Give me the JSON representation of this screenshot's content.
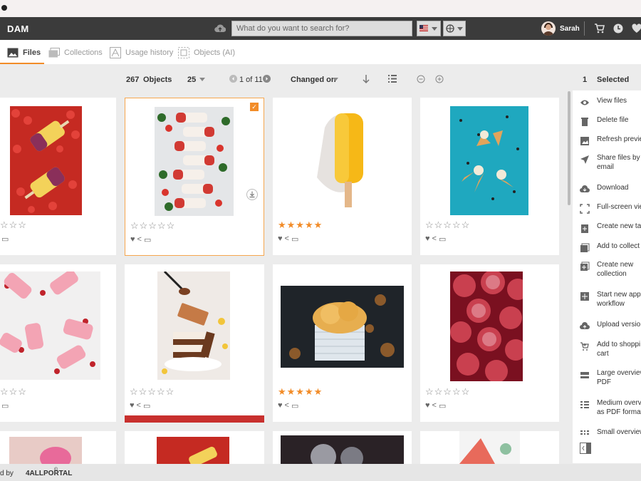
{
  "app": {
    "logo": "DAM"
  },
  "search": {
    "placeholder": "What do you want to search for?"
  },
  "user": {
    "name": "Sarah"
  },
  "tabs": [
    {
      "label": "Files",
      "active": true
    },
    {
      "label": "Collections"
    },
    {
      "label": "Usage history"
    },
    {
      "label": "Objects (AI)"
    }
  ],
  "toolbar": {
    "count": "267",
    "objects_label": "Objects",
    "page_size": "25",
    "pager": "1 of 11",
    "sort": "Changed on"
  },
  "sidebar": {
    "selected_count": "1",
    "selected_label": "Selected",
    "items": [
      {
        "label": "View files",
        "icon": "eye-icon"
      },
      {
        "label": "Delete file",
        "icon": "trash-icon"
      },
      {
        "label": "Refresh previe",
        "icon": "image-refresh-icon"
      },
      {
        "label": "Share files by\nemail",
        "icon": "send-icon"
      },
      {
        "label": "Download",
        "icon": "cloud-download-icon"
      },
      {
        "label": "Full-screen vie",
        "icon": "fullscreen-icon"
      },
      {
        "label": "Create new tas",
        "icon": "clipboard-add-icon"
      },
      {
        "label": "Add to collect",
        "icon": "collection-add-icon"
      },
      {
        "label": "Create new\ncollection",
        "icon": "new-collection-icon"
      },
      {
        "label": "Start new appr\nworkflow",
        "icon": "workflow-add-icon"
      },
      {
        "label": "Upload versio",
        "icon": "upload-icon"
      },
      {
        "label": "Add to shoppi\ncart",
        "icon": "cart-add-icon"
      },
      {
        "label": "Large overview\nPDF",
        "icon": "pdf-large-icon"
      },
      {
        "label": "Medium overvi\nas PDF format",
        "icon": "pdf-medium-icon"
      },
      {
        "label": "Small overview",
        "icon": "pdf-small-icon"
      }
    ]
  },
  "cards": [
    {
      "rating": 0,
      "stars_shown": 3,
      "gold": false
    },
    {
      "rating": 0,
      "stars_shown": 5,
      "gold": false,
      "selected": true
    },
    {
      "rating": 5,
      "stars_shown": 5,
      "gold": true
    },
    {
      "rating": 0,
      "stars_shown": 5,
      "gold": false
    },
    {
      "rating": 0,
      "stars_shown": 3,
      "gold": false
    },
    {
      "rating": 0,
      "stars_shown": 5,
      "gold": false
    },
    {
      "rating": 5,
      "stars_shown": 5,
      "gold": true
    },
    {
      "rating": 0,
      "stars_shown": 5,
      "gold": false
    }
  ],
  "footer": {
    "prefix": "d by",
    "brand": "4ALLPORTAL",
    "mark": "©"
  },
  "colors": {
    "accent": "#f28c28",
    "topbar": "#3b3b3b",
    "selection_bar": "#c8302e"
  }
}
